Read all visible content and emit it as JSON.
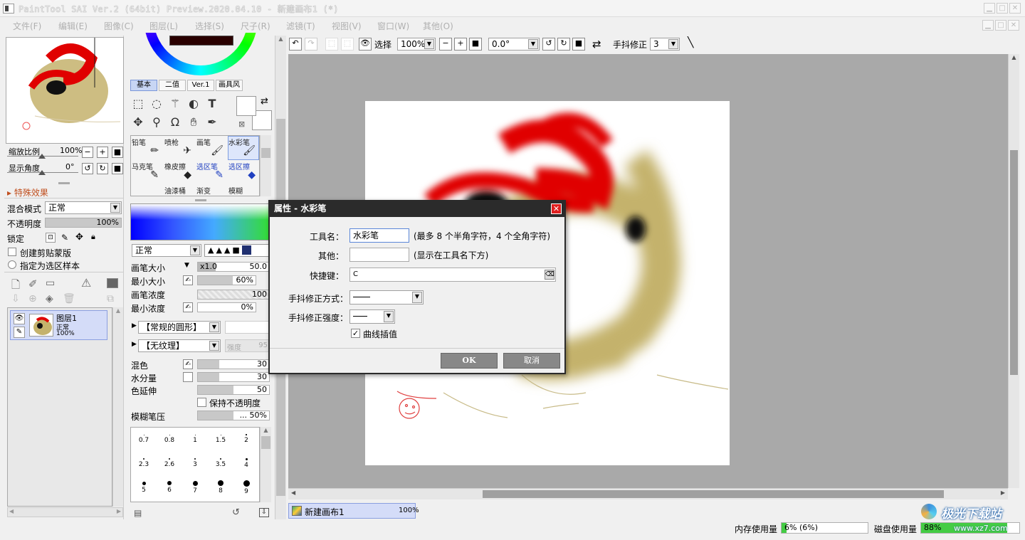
{
  "window": {
    "title": "PaintTool SAI Ver.2 (64bit) Preview.2020.04.10 - 新建画布1 (*)",
    "min": "▁",
    "max": "□",
    "close": "✕"
  },
  "menu": [
    "文件(F)",
    "编辑(E)",
    "图像(C)",
    "图层(L)",
    "选择(S)",
    "尺子(R)",
    "滤镜(T)",
    "视图(V)",
    "窗口(W)",
    "其他(O)"
  ],
  "navigator": {
    "zoom_label": "缩放比例",
    "zoom_value": "100%",
    "angle_label": "显示角度",
    "angle_value": "0°"
  },
  "special_effects": "特殊效果",
  "layer_props": {
    "blend_label": "混合模式",
    "blend_value": "正常",
    "opacity_label": "不透明度",
    "opacity_value": "100%",
    "lock_label": "锁定",
    "clip_label": "创建剪贴蒙版",
    "select_sample_label": "指定为选区样本"
  },
  "layer": {
    "name": "图层1",
    "mode": "正常",
    "opacity": "100%"
  },
  "color_tabs": [
    "基本",
    "二值",
    "Ver.1",
    "画具风"
  ],
  "brushes": {
    "row1": [
      "铅笔",
      "喷枪",
      "画笔",
      "水彩笔"
    ],
    "row2": [
      "马克笔",
      "橡皮擦",
      "选区笔",
      "选区擦"
    ],
    "row3": [
      "",
      "油漆桶",
      "渐变",
      "模糊"
    ]
  },
  "brush_settings": {
    "mode": "正常",
    "size_label": "画笔大小",
    "size_mult": "x1.0",
    "size_value": "50.0",
    "minsize_label": "最小大小",
    "minsize_value": "60%",
    "density_label": "画笔浓度",
    "density_value": "100",
    "mindensity_label": "最小浓度",
    "mindensity_value": "0%",
    "shape": "【常规的圆形】",
    "texture": "【无纹理】",
    "strength_label": "强度",
    "strength_value": "95",
    "blend_label": "混色",
    "blend_value": "30",
    "water_label": "水分量",
    "water_value": "30",
    "persist_label": "色延伸",
    "persist_value": "50",
    "keep_opacity_label": "保持不透明度",
    "blur_label": "模糊笔压",
    "blur_value": "... 50%"
  },
  "presets": [
    "0.7",
    "0.8",
    "1",
    "1.5",
    "2",
    "2.3",
    "2.6",
    "3",
    "3.5",
    "4",
    "5",
    "6",
    "7",
    "8",
    "9"
  ],
  "toolbar": {
    "select_label": "选择",
    "zoom": "100%",
    "angle": "0.0°",
    "stabilizer_label": "手抖修正",
    "stabilizer_value": "3"
  },
  "dialog": {
    "title": "属性 - 水彩笔",
    "name_label": "工具名：",
    "name_value": "水彩笔",
    "name_hint": "(最多 8 个半角字符，4 个全角字符)",
    "other_label": "其他：",
    "other_value": "",
    "other_hint": "(显示在工具名下方)",
    "shortcut_label": "快捷键：",
    "shortcut_value": "C",
    "stab_method_label": "手抖修正方式：",
    "stab_strength_label": "手抖修正强度：",
    "curve_label": "曲线插值",
    "ok": "OK",
    "cancel": "取消"
  },
  "canvas_tab": {
    "name": "新建画布1",
    "zoom": "100%"
  },
  "status": {
    "mem_label": "内存使用量",
    "mem_value": "6% (6%)",
    "disk_label": "磁盘使用量",
    "disk_value": "88%"
  },
  "watermark": {
    "text": "极光下载站",
    "url": "www.xz7.com"
  },
  "colors": {
    "accent": "#c8d6f4",
    "dialog_title": "#2b2b2b",
    "canvas_bg": "#a9a9a9",
    "paint_red": "#e00000",
    "paint_olive": "#c4b26c"
  }
}
